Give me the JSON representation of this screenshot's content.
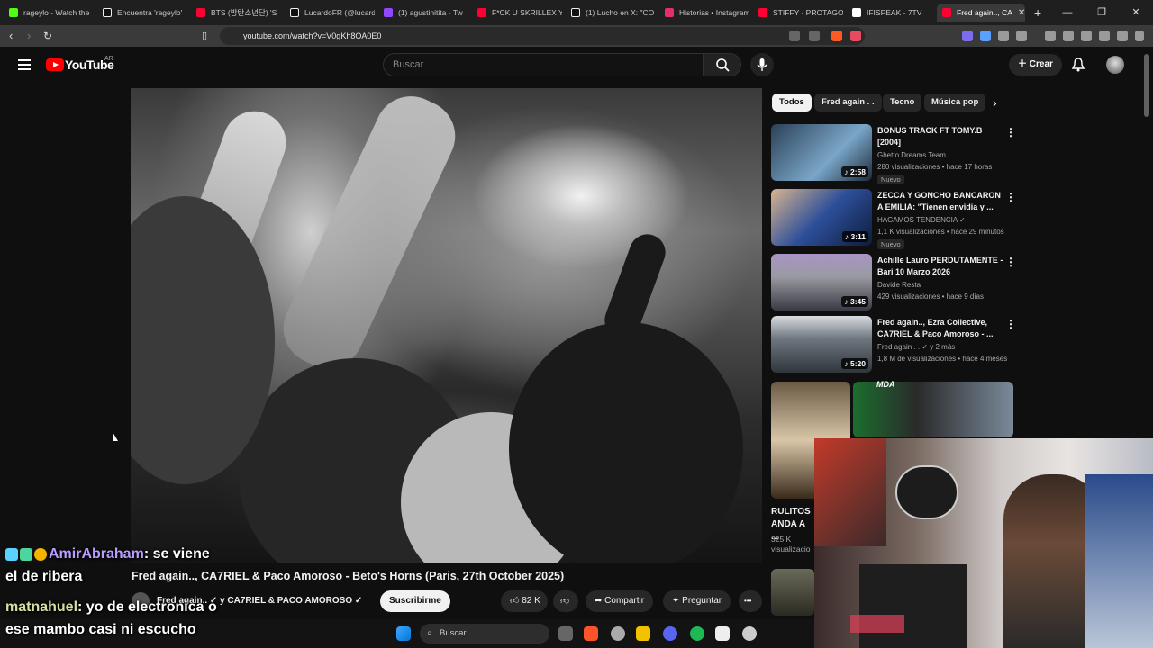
{
  "browser": {
    "tabs": [
      {
        "label": "rageylo - Watch the",
        "color": "#53fc18"
      },
      {
        "label": "Encuentra 'rageylo'",
        "color": "#111111"
      },
      {
        "label": "BTS (방탄소년단) 'S",
        "color": "#ff0033"
      },
      {
        "label": "LucardoFR (@lucard",
        "color": "#111111"
      },
      {
        "label": "(1) agustinitita - Tw",
        "color": "#9146ff"
      },
      {
        "label": "F*CK U SKRILLEX YO",
        "color": "#ff0033"
      },
      {
        "label": "(1) Lucho en X: \"CO",
        "color": "#111111"
      },
      {
        "label": "Historias • Instagram",
        "color": "#e1306c"
      },
      {
        "label": "STIFFY - PROTAGON",
        "color": "#ff0033"
      },
      {
        "label": "IFISPEAK - 7TV",
        "color": "#ffffff"
      },
      {
        "label": "Fred again.., CA",
        "color": "#ff0033"
      }
    ],
    "window_controls": [
      "—",
      "❐",
      "✕"
    ],
    "url": "youtube.com/watch?v=V0gKh8OA0E0"
  },
  "youtube": {
    "logo_text": "YouTube",
    "country": "AR",
    "search_placeholder": "Buscar",
    "create_label": "Crear"
  },
  "video": {
    "title": "Fred again.., CA7RIEL & Paco Amoroso - Beto's Horns (Paris, 27th October 2025)",
    "channel": "Fred again.. ✓ y CA7RIEL & PACO AMOROSO ✓",
    "subscribe_label": "Suscribirme",
    "likes": "82 K",
    "share_label": "Compartir",
    "ask_label": "Preguntar",
    "more": "•••"
  },
  "chat": [
    {
      "user": "AmirAbraham",
      "message": "se viene",
      "continuation": "el de ribera"
    },
    {
      "user": "matnahuel",
      "message": "yo de electronica o",
      "continuation": "ese mambo casi ni escucho"
    }
  ],
  "chips": [
    {
      "label": "Todos",
      "active": true
    },
    {
      "label": "Fred again . .",
      "active": false
    },
    {
      "label": "Tecno",
      "active": false
    },
    {
      "label": "Música pop",
      "active": false
    }
  ],
  "recommendations": [
    {
      "title": "BONUS TRACK FT TOMY.B [2004]",
      "channel": "Ghetto Dreams Team",
      "meta": "280 visualizaciones • hace 17 horas",
      "badge": "Nuevo",
      "duration": "♪ 2:58",
      "thumb": "#4a6d8c"
    },
    {
      "title": "ZECCA Y GONCHO BANCARON A EMILIA: \"Tienen envidia y ...",
      "channel": "HAGAMOS TENDENCIA ✓",
      "meta": "1,1 K visualizaciones • hace 29 minutos",
      "badge": "Nuevo",
      "duration": "♪ 3:11",
      "thumb": "#2d4f9a"
    },
    {
      "title": "Achille Lauro PERDUTAMENTE - Bari 10 Marzo 2026",
      "channel": "Davide Resta",
      "meta": "429 visualizaciones • hace 9 días",
      "badge": "",
      "duration": "♪ 3:45",
      "thumb": "#8a8a94"
    },
    {
      "title": "Fred again.., Ezra Collective, CA7RIEL & Paco Amoroso - ...",
      "channel": "Fred again . . ✓ y 2 más",
      "meta": "1,8 M de visualizaciones • hace 4 meses",
      "badge": "",
      "duration": "♪ 5:20",
      "thumb": "#6e767f"
    }
  ],
  "shorts": {
    "header": "MDA",
    "title": "RULITOS ANDA A ...",
    "views": "325 K visualizacio"
  },
  "taskbar": {
    "search_label": "Buscar"
  }
}
